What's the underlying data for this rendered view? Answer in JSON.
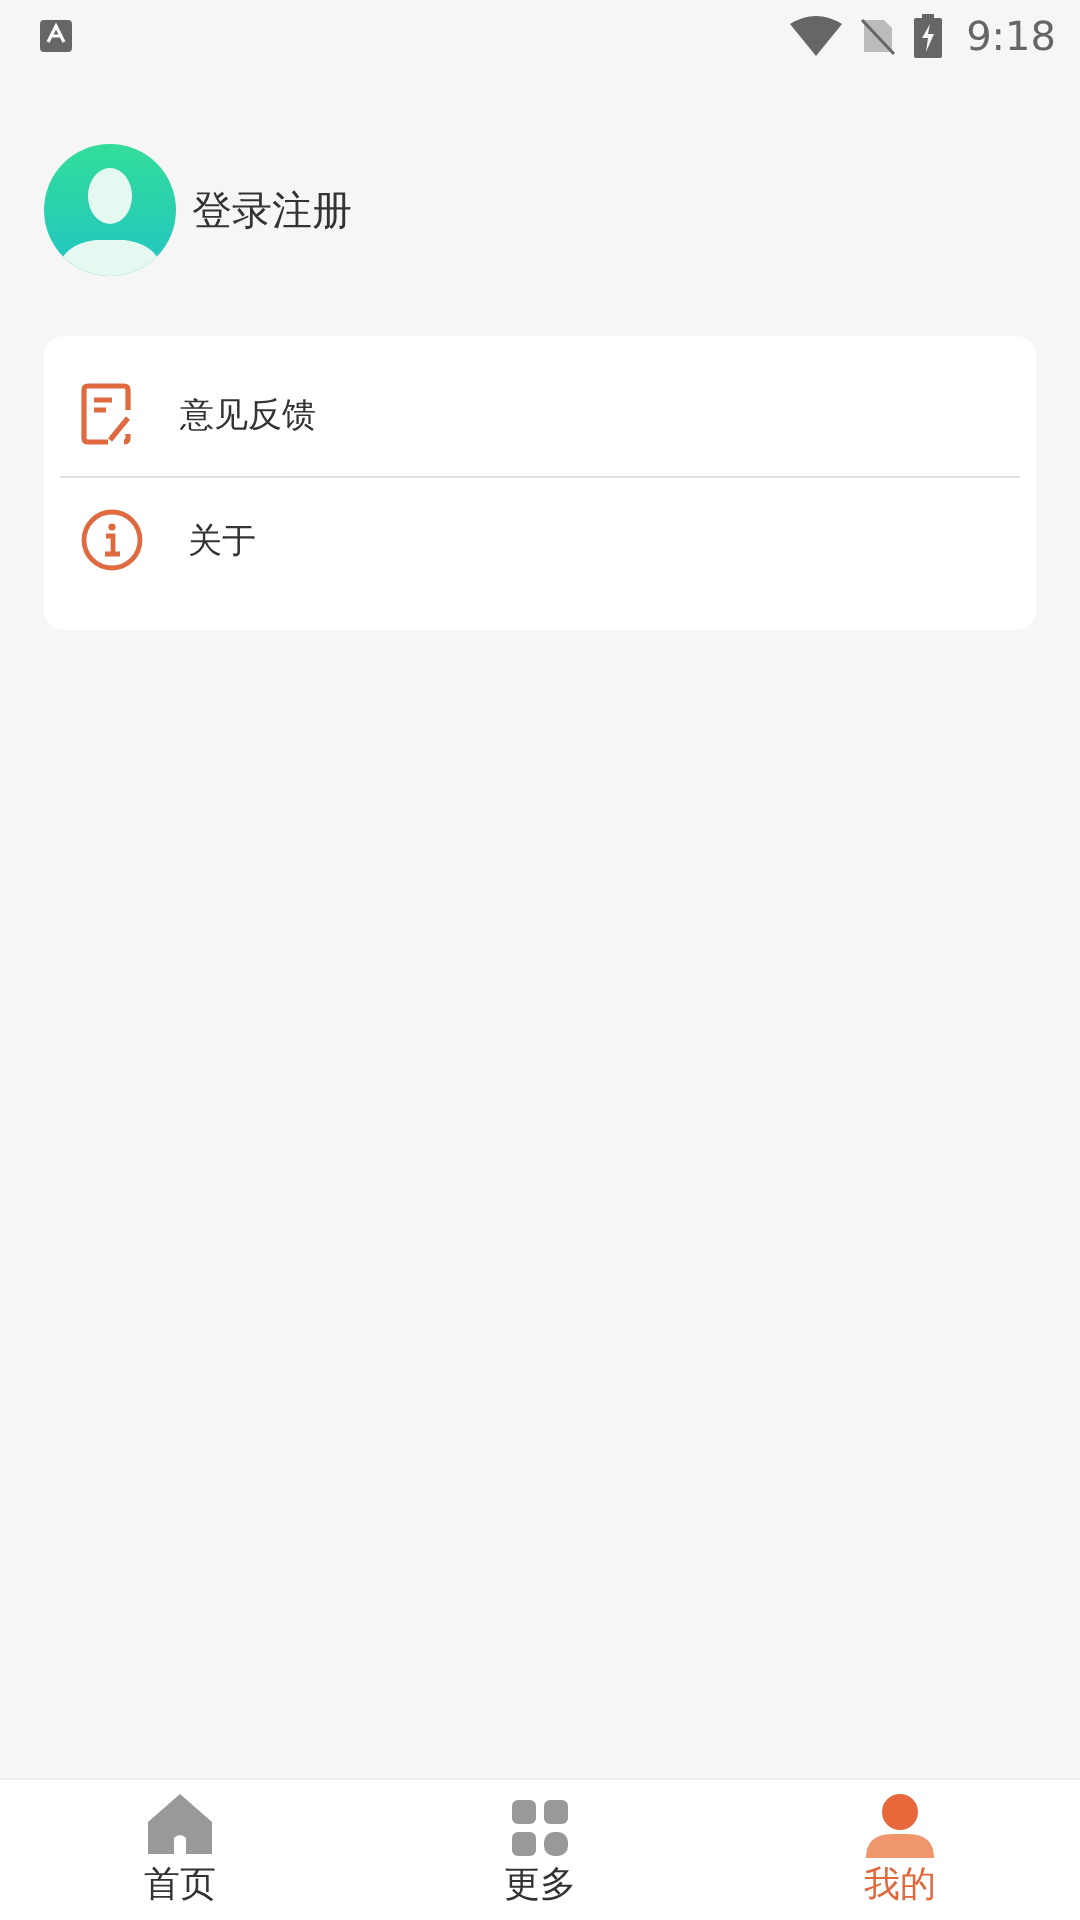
{
  "status_bar": {
    "time": "9:18"
  },
  "profile": {
    "label": "登录注册"
  },
  "menu": [
    {
      "kind": "feedback",
      "label": "意见反馈"
    },
    {
      "kind": "info",
      "label": "关于"
    }
  ],
  "tabs": [
    {
      "kind": "home",
      "label": "首页",
      "selected": false
    },
    {
      "kind": "grid",
      "label": "更多",
      "selected": false
    },
    {
      "kind": "person",
      "label": "我的",
      "selected": true
    }
  ]
}
